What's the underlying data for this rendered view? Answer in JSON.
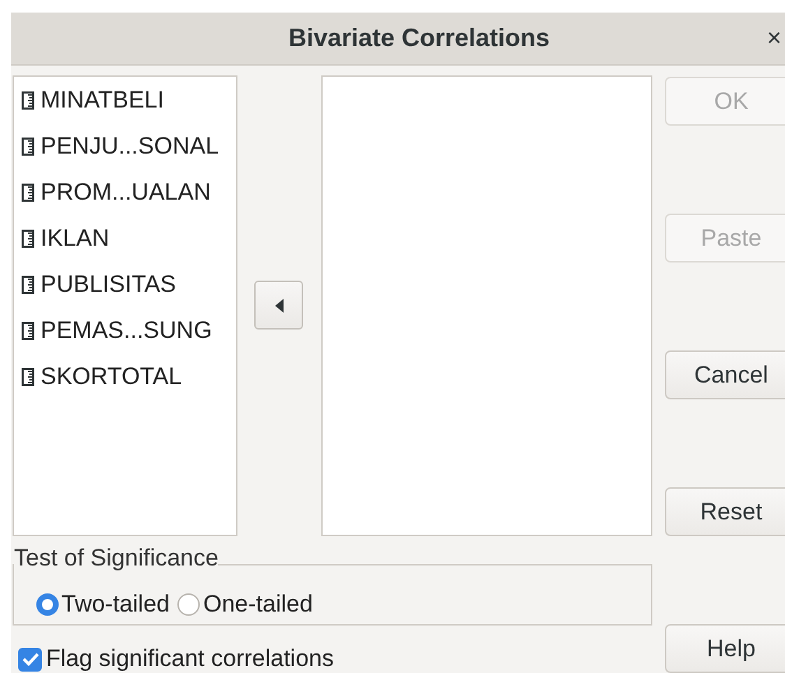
{
  "window": {
    "title": "Bivariate Correlations",
    "close": "×"
  },
  "variables": [
    {
      "name": "MINATBELI"
    },
    {
      "name": "PENJU...SONAL"
    },
    {
      "name": "PROM...UALAN"
    },
    {
      "name": "IKLAN"
    },
    {
      "name": "PUBLISITAS"
    },
    {
      "name": "PEMAS...SUNG"
    },
    {
      "name": "SKORTOTAL"
    }
  ],
  "test_of_significance": {
    "title": "Test of Significance",
    "options": [
      {
        "label": "Two-tailed",
        "selected": true
      },
      {
        "label": "One-tailed",
        "selected": false
      }
    ]
  },
  "flag_significant": {
    "label": "Flag significant correlations",
    "checked": true
  },
  "buttons": [
    {
      "label": "OK",
      "disabled": true
    },
    {
      "label": "Paste",
      "disabled": true
    },
    {
      "label": "Cancel",
      "disabled": false
    },
    {
      "label": "Reset",
      "disabled": false
    },
    {
      "label": "Help",
      "disabled": false
    }
  ]
}
